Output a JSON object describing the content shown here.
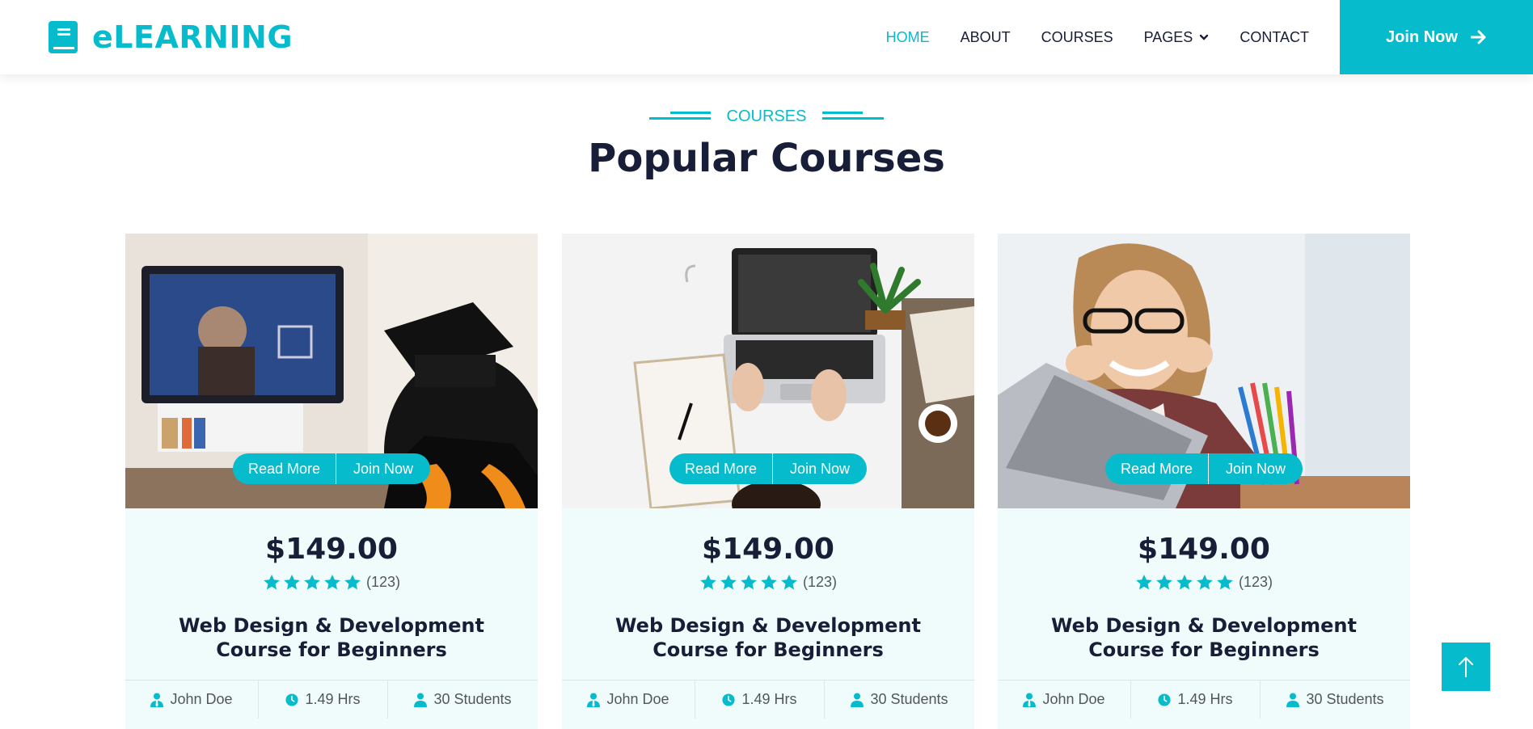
{
  "brand": {
    "name": "eLEARNING",
    "icon": "book-icon"
  },
  "nav": {
    "items": [
      {
        "label": "HOME",
        "active": true
      },
      {
        "label": "ABOUT",
        "active": false
      },
      {
        "label": "COURSES",
        "active": false
      },
      {
        "label": "PAGES",
        "active": false,
        "dropdown": true
      },
      {
        "label": "CONTACT",
        "active": false
      }
    ],
    "join_label": "Join Now"
  },
  "section": {
    "subtitle": "COURSES",
    "title": "Popular Courses"
  },
  "colors": {
    "accent": "#06bbcc",
    "dark": "#181d38",
    "card_bg": "#f0fbfc"
  },
  "courses": [
    {
      "image": "graduate-watching-tv-photo",
      "read_more": "Read More",
      "join_now": "Join Now",
      "price": "$149.00",
      "stars": 5,
      "reviews": "(123)",
      "title": "Web Design & Development Course for Beginners",
      "instructor": "John Doe",
      "duration": "1.49 Hrs",
      "students": "30 Students"
    },
    {
      "image": "laptop-desk-photo",
      "read_more": "Read More",
      "join_now": "Join Now",
      "price": "$149.00",
      "stars": 5,
      "reviews": "(123)",
      "title": "Web Design & Development Course for Beginners",
      "instructor": "John Doe",
      "duration": "1.49 Hrs",
      "students": "30 Students"
    },
    {
      "image": "student-with-laptop-photo",
      "read_more": "Read More",
      "join_now": "Join Now",
      "price": "$149.00",
      "stars": 5,
      "reviews": "(123)",
      "title": "Web Design & Development Course for Beginners",
      "instructor": "John Doe",
      "duration": "1.49 Hrs",
      "students": "30 Students"
    }
  ],
  "back_to_top": {
    "icon": "arrow-up-icon"
  }
}
